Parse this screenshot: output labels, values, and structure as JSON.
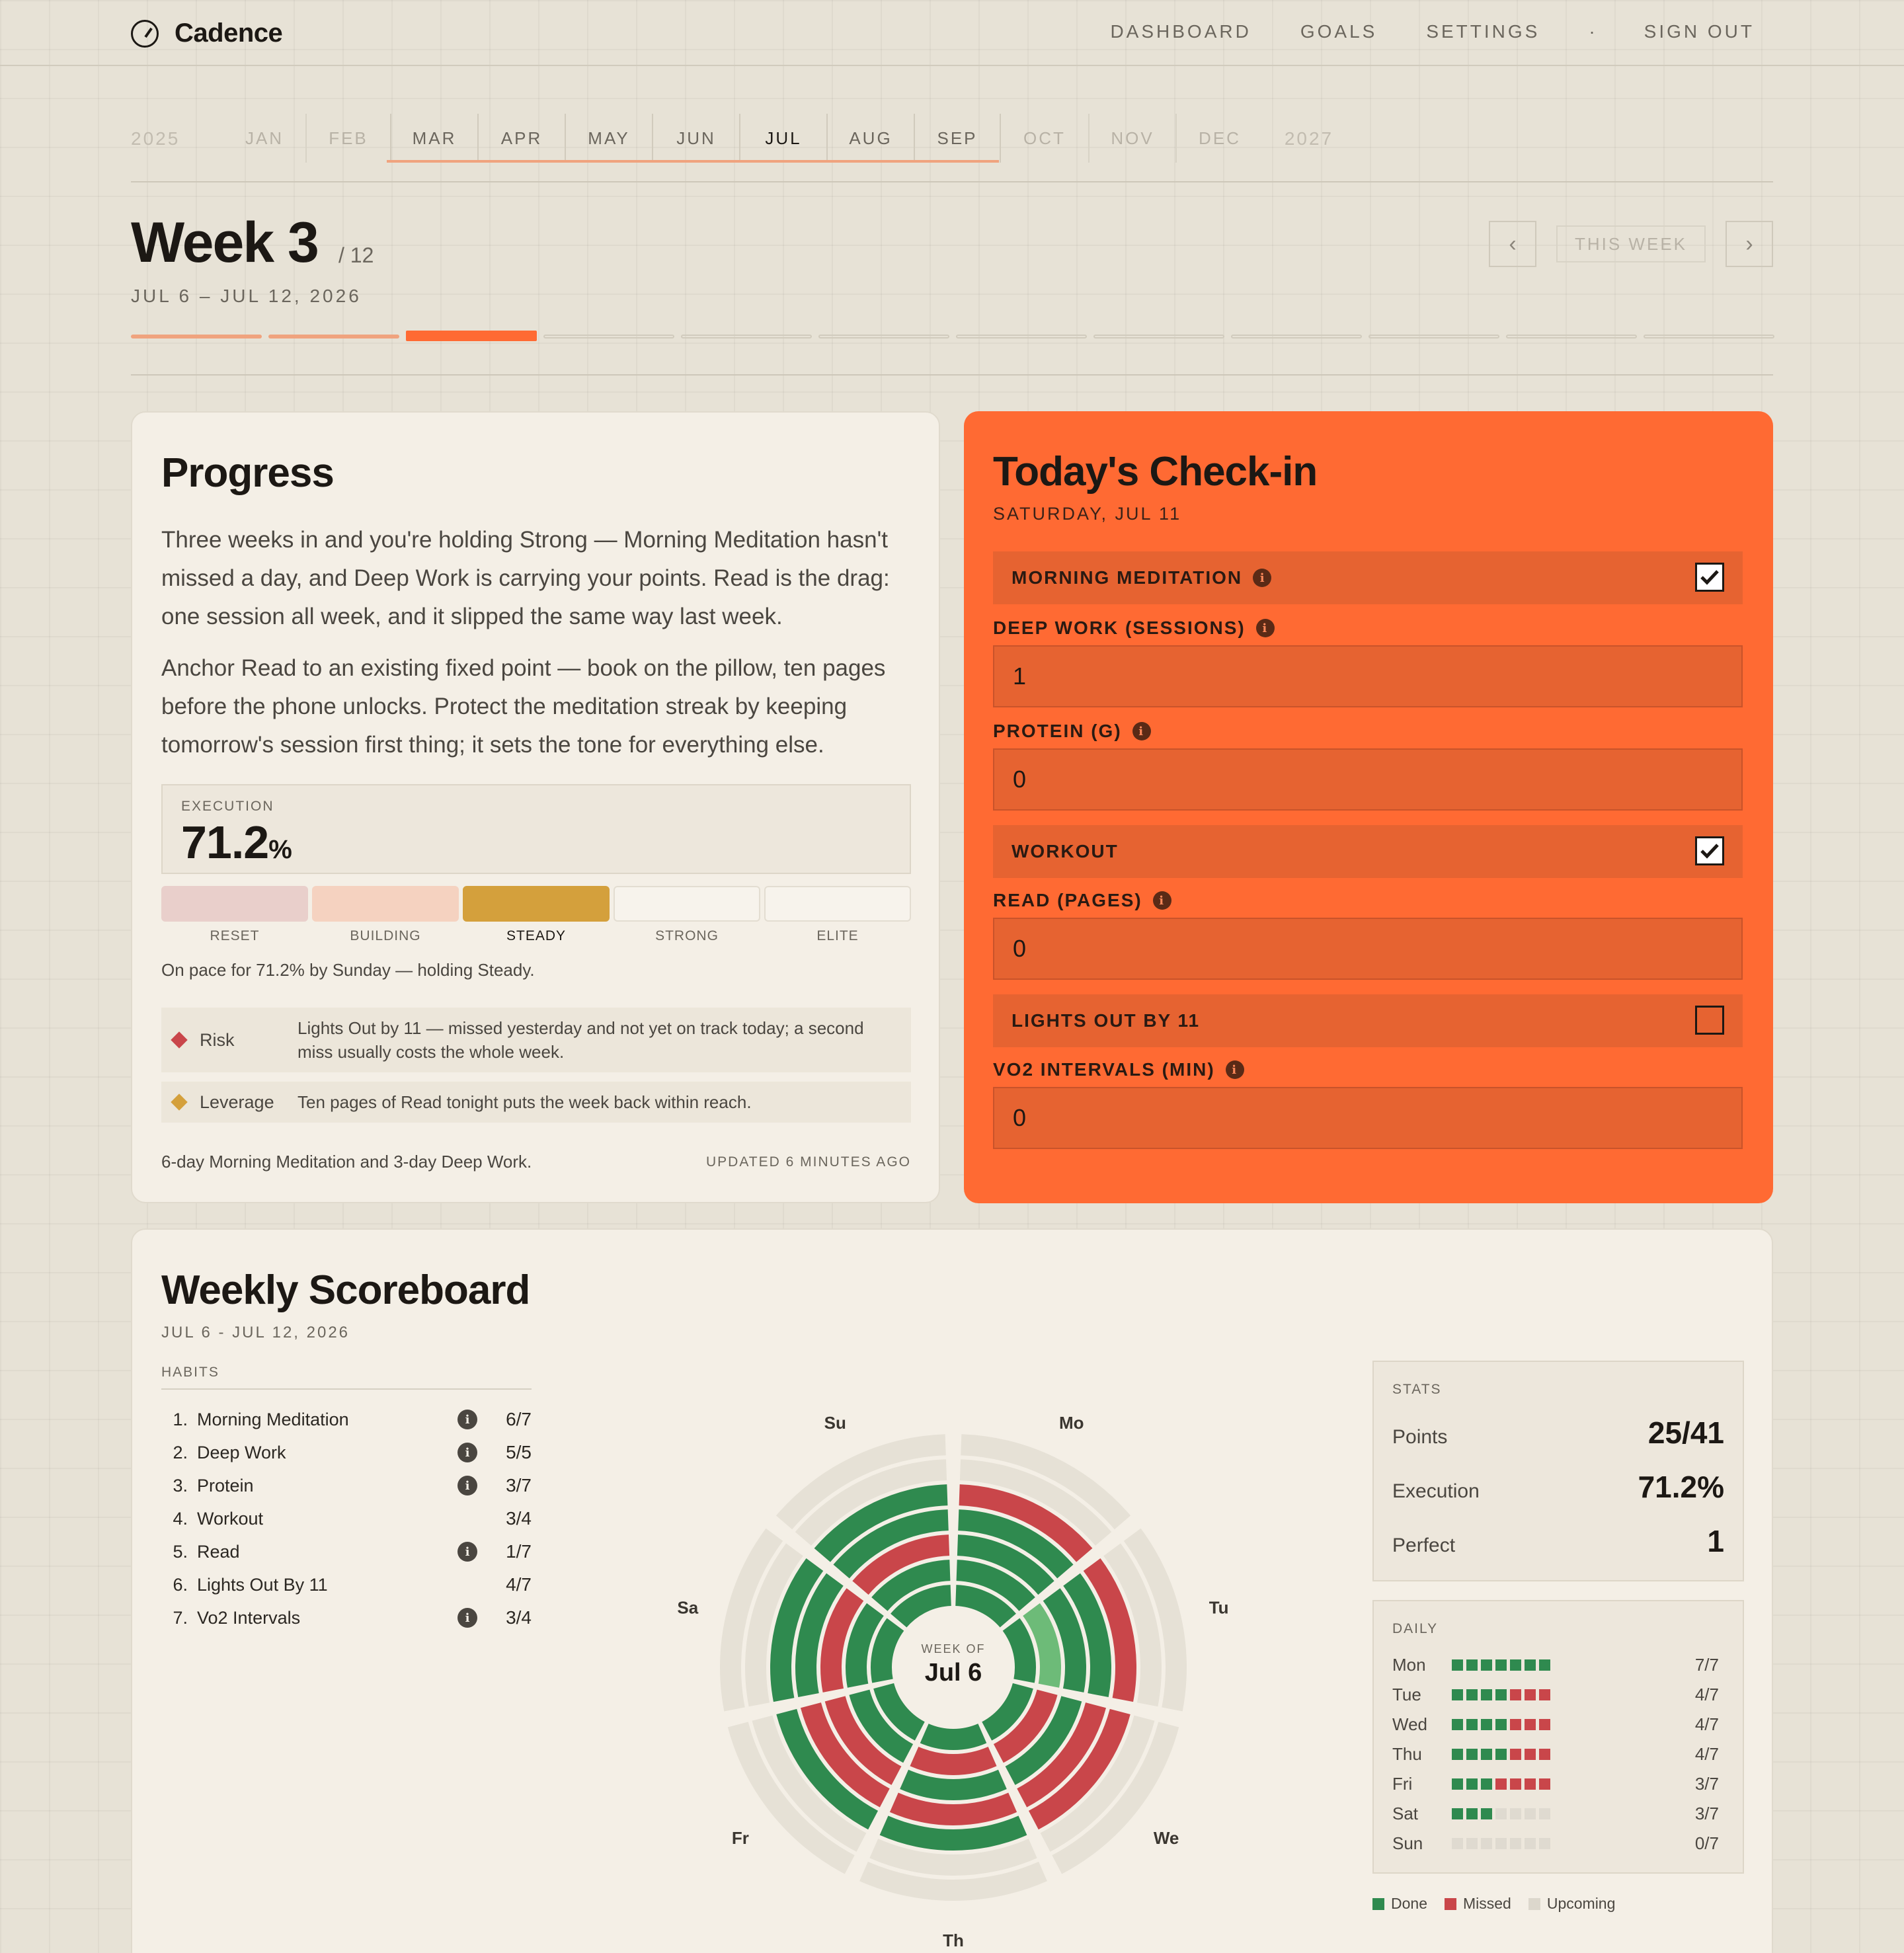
{
  "app": {
    "name": "Cadence"
  },
  "nav": {
    "items": [
      "DASHBOARD",
      "GOALS",
      "SETTINGS",
      "SIGN OUT"
    ],
    "separator": "·"
  },
  "months": {
    "year_prev": "2025",
    "items": [
      "JAN",
      "FEB",
      "MAR",
      "APR",
      "MAY",
      "JUN",
      "JUL",
      "AUG",
      "SEP",
      "OCT",
      "NOV",
      "DEC"
    ],
    "year_next": "2027",
    "active_range": [
      "MAR",
      "SEP"
    ],
    "current": "JUL"
  },
  "week": {
    "title": "Week 3",
    "of": "/ 12",
    "dates": "JUL 6 – JUL 12, 2026",
    "this_week_label": "THIS WEEK",
    "current_index": 3,
    "total": 12
  },
  "progress": {
    "title": "Progress",
    "para1": "Three weeks in and you're holding Strong — Morning Meditation hasn't missed a day, and Deep Work is carrying your points. Read is the drag: one session all week, and it slipped the same way last week.",
    "para2": "Anchor Read to an existing fixed point — book on the pillow, ten pages before the phone unlocks. Protect the meditation streak by keeping tomorrow's session first thing; it sets the tone for everything else.",
    "execution_label": "EXECUTION",
    "execution_value": "71.2",
    "execution_unit": "%",
    "tiers": [
      "RESET",
      "BUILDING",
      "STEADY",
      "STRONG",
      "ELITE"
    ],
    "current_tier": "STEADY",
    "pace": "On pace for 71.2% by Sunday — holding Steady.",
    "risk_label": "Risk",
    "risk_text": "Lights Out by 11 — missed yesterday and not yet on track today; a second miss usually costs the whole week.",
    "leverage_label": "Leverage",
    "leverage_text": "Ten pages of Read tonight puts the week back within reach.",
    "streaks": "6-day Morning Meditation and 3-day Deep Work.",
    "updated": "UPDATED 6 MINUTES AGO"
  },
  "checkin": {
    "title": "Today's Check-in",
    "date": "SATURDAY, JUL 11",
    "morning_meditation": {
      "label": "MORNING MEDITATION",
      "checked": true
    },
    "deep_work": {
      "label": "DEEP WORK (SESSIONS)",
      "value": "1"
    },
    "protein": {
      "label": "PROTEIN (G)",
      "value": "0"
    },
    "workout": {
      "label": "WORKOUT",
      "checked": true
    },
    "read": {
      "label": "READ (PAGES)",
      "value": "0"
    },
    "lights_out": {
      "label": "LIGHTS OUT BY 11",
      "checked": false
    },
    "vo2": {
      "label": "VO2 INTERVALS (MIN)",
      "value": "0"
    }
  },
  "scoreboard": {
    "title": "Weekly Scoreboard",
    "dates": "JUL 6 - JUL 12, 2026",
    "habits_header": "HABITS",
    "habits": [
      {
        "num": "1.",
        "name": "Morning Meditation",
        "info": true,
        "value": "6/7"
      },
      {
        "num": "2.",
        "name": "Deep Work",
        "info": true,
        "value": "5/5"
      },
      {
        "num": "3.",
        "name": "Protein",
        "info": true,
        "value": "3/7"
      },
      {
        "num": "4.",
        "name": "Workout",
        "info": false,
        "value": "3/4"
      },
      {
        "num": "5.",
        "name": "Read",
        "info": true,
        "value": "1/7"
      },
      {
        "num": "6.",
        "name": "Lights Out By 11",
        "info": false,
        "value": "4/7"
      },
      {
        "num": "7.",
        "name": "Vo2 Intervals",
        "info": true,
        "value": "3/4"
      }
    ],
    "radial": {
      "center_top": "WEEK OF",
      "center_main": "Jul 6",
      "days": [
        "Mo",
        "Tu",
        "We",
        "Th",
        "Fr",
        "Sa",
        "Su"
      ],
      "status": [
        [
          "done",
          "done",
          "done",
          "done",
          "done",
          "done",
          "done"
        ],
        [
          "done",
          "missed",
          "missed",
          "missed",
          "done",
          "done",
          "done"
        ],
        [
          "done",
          "done",
          "done",
          "done",
          "missed",
          "missed",
          "missed"
        ],
        [
          "done",
          "done",
          "missed",
          "missed",
          "missed",
          "done",
          "done"
        ],
        [
          "missed",
          "missed",
          "missed",
          "done",
          "done",
          "done",
          "done"
        ],
        [
          "upcoming",
          "upcoming",
          "upcoming",
          "upcoming",
          "upcoming",
          "upcoming",
          "upcoming"
        ],
        [
          "upcoming",
          "upcoming",
          "upcoming",
          "upcoming",
          "upcoming",
          "upcoming",
          "upcoming"
        ]
      ],
      "today_highlight": {
        "day": "Tu",
        "ring": 1
      }
    },
    "stats": {
      "header": "STATS",
      "points_label": "Points",
      "points": "25/41",
      "execution_label": "Execution",
      "execution": "71.2%",
      "perfect_label": "Perfect",
      "perfect": "1"
    },
    "daily": {
      "header": "DAILY",
      "rows": [
        {
          "day": "Mon",
          "value": "7/7",
          "cells": [
            "d",
            "d",
            "d",
            "d",
            "d",
            "d",
            "d"
          ]
        },
        {
          "day": "Tue",
          "value": "4/7",
          "cells": [
            "d",
            "d",
            "d",
            "d",
            "m",
            "m",
            "m"
          ]
        },
        {
          "day": "Wed",
          "value": "4/7",
          "cells": [
            "d",
            "d",
            "d",
            "d",
            "m",
            "m",
            "m"
          ]
        },
        {
          "day": "Thu",
          "value": "4/7",
          "cells": [
            "d",
            "d",
            "d",
            "d",
            "m",
            "m",
            "m"
          ]
        },
        {
          "day": "Fri",
          "value": "3/7",
          "cells": [
            "d",
            "d",
            "d",
            "m",
            "m",
            "m",
            "m"
          ]
        },
        {
          "day": "Sat",
          "value": "3/7",
          "cells": [
            "d",
            "d",
            "d",
            "u",
            "u",
            "u",
            "u"
          ]
        },
        {
          "day": "Sun",
          "value": "0/7",
          "cells": [
            "u",
            "u",
            "u",
            "u",
            "u",
            "u",
            "u"
          ]
        }
      ]
    },
    "legend": {
      "done": "Done",
      "missed": "Missed",
      "upcoming": "Upcoming"
    }
  },
  "colors": {
    "accent": "#ff6a33",
    "done": "#2f8a4f",
    "done_light": "#6dbb78",
    "missed": "#c9464a",
    "upcoming": "#e6e1d6",
    "steady": "#d4a03c"
  }
}
